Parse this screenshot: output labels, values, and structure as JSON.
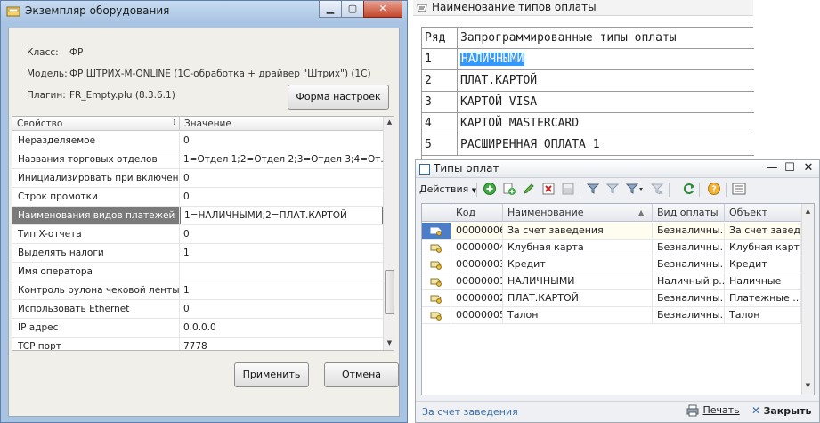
{
  "colors": {
    "accent": "#3399ff",
    "selected_row_bg": "#7a7a7a",
    "close_button": "#c2452b",
    "list_link": "#3a6ea5"
  },
  "equipment_window": {
    "title": "Экземпляр оборудования",
    "class_label": "Класс:",
    "class_value": "ФР",
    "model_label": "Модель:",
    "model_value": "ФР ШТРИХ-М-ONLINE (1С-обработка + драйвер \"Штрих\") (1С)",
    "plugin_label": "Плагин:",
    "plugin_value": "FR_Empty.plu (8.3.6.1)",
    "settings_form_button": "Форма настроек",
    "columns": {
      "property": "Свойство",
      "value": "Значение"
    },
    "properties": [
      {
        "name": "Неразделяемое",
        "value": "0"
      },
      {
        "name": "Названия торговых отделов",
        "value": "1=Отдел 1;2=Отдел 2;3=Отдел 3;4=От..."
      },
      {
        "name": "Инициализировать при включении",
        "value": "0"
      },
      {
        "name": "Строк промотки",
        "value": "0"
      },
      {
        "name": "Наименования видов платежей",
        "value": "1=НАЛИЧНЫМИ;2=ПЛАТ.КАРТОЙ"
      },
      {
        "name": "Тип X-отчета",
        "value": "0"
      },
      {
        "name": "Выделять налоги",
        "value": "1"
      },
      {
        "name": "Имя оператора",
        "value": ""
      },
      {
        "name": "Контроль рулона чековой ленты",
        "value": "1"
      },
      {
        "name": "Использовать Ethernet",
        "value": "0"
      },
      {
        "name": "IP адрес",
        "value": "0.0.0.0"
      },
      {
        "name": "TCP порт",
        "value": "7778"
      }
    ],
    "apply_button": "Применить",
    "cancel_button": "Отмена"
  },
  "payment_names_window": {
    "title": "Наименование типов оплаты",
    "headers": {
      "row": "Ряд",
      "programmed": "Запрограммированные типы оплаты"
    },
    "rows": [
      {
        "n": "1",
        "name": "НАЛИЧНЫМИ"
      },
      {
        "n": "2",
        "name": "ПЛАТ.КАРТОЙ"
      },
      {
        "n": "3",
        "name": "КАРТОЙ VISA"
      },
      {
        "n": "4",
        "name": "КАРТОЙ MASTERCARD"
      },
      {
        "n": "5",
        "name": "РАСШИРЕННАЯ ОПЛАТА 1"
      }
    ]
  },
  "payment_types_window": {
    "title": "Типы оплат",
    "actions_menu": "Действия",
    "columns": {
      "code": "Код",
      "name": "Наименование",
      "kind": "Вид оплаты",
      "object": "Объект"
    },
    "rows": [
      {
        "code": "00000006",
        "name": "За счет заведения",
        "kind": "Безналичны...",
        "object": "За счет заведе"
      },
      {
        "code": "00000004",
        "name": "Клубная карта",
        "kind": "Безналичны...",
        "object": "Клубная карта"
      },
      {
        "code": "00000003",
        "name": "Кредит",
        "kind": "Безналичны...",
        "object": "Кредит"
      },
      {
        "code": "00000001",
        "name": "НАЛИЧНЫМИ",
        "kind": "Наличный р...",
        "object": "Наличные"
      },
      {
        "code": "00000002",
        "name": "ПЛАТ.КАРТОЙ",
        "kind": "Безналичны...",
        "object": "Платежные ..."
      },
      {
        "code": "00000005",
        "name": "Талон",
        "kind": "Безналичны...",
        "object": "Талон"
      }
    ],
    "status_text": "За счет заведения",
    "print_button": "Печать",
    "close_button": "Закрыть"
  }
}
